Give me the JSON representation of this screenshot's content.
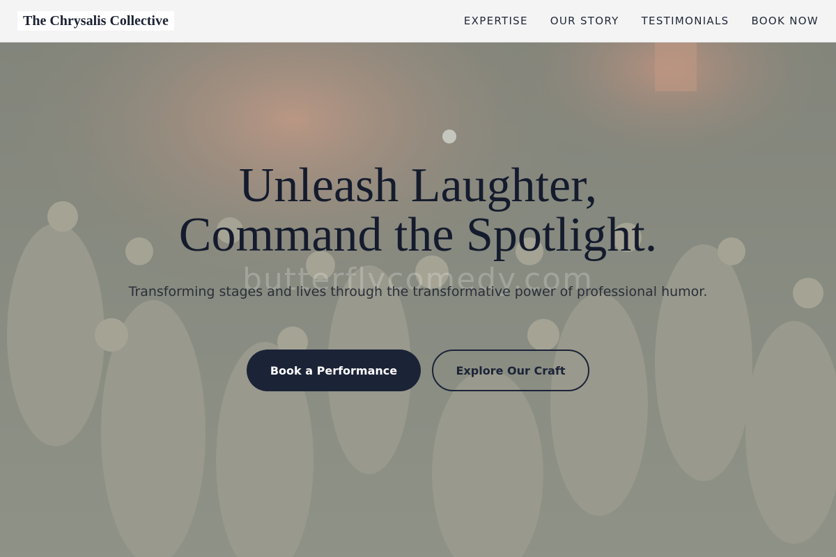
{
  "header": {
    "logo_text": "The Chrysalis Collective",
    "nav": [
      {
        "label": "EXPERTISE"
      },
      {
        "label": "OUR STORY"
      },
      {
        "label": "TESTIMONIALS"
      },
      {
        "label": "BOOK NOW"
      }
    ]
  },
  "hero": {
    "headline_line1": "Unleash Laughter,",
    "headline_line2": "Command the Spotlight.",
    "subtitle": "Transforming stages and lives through the transformative power of professional humor.",
    "watermark_text": "butterflycomedy.com",
    "primary_button": "Book a Performance",
    "secondary_button": "Explore Our Craft",
    "background_image": "concert-crowd-photo"
  },
  "colors": {
    "navy": "#1b2337",
    "header_bg": "#f4f4f4",
    "overlay": "#b6beb0"
  }
}
